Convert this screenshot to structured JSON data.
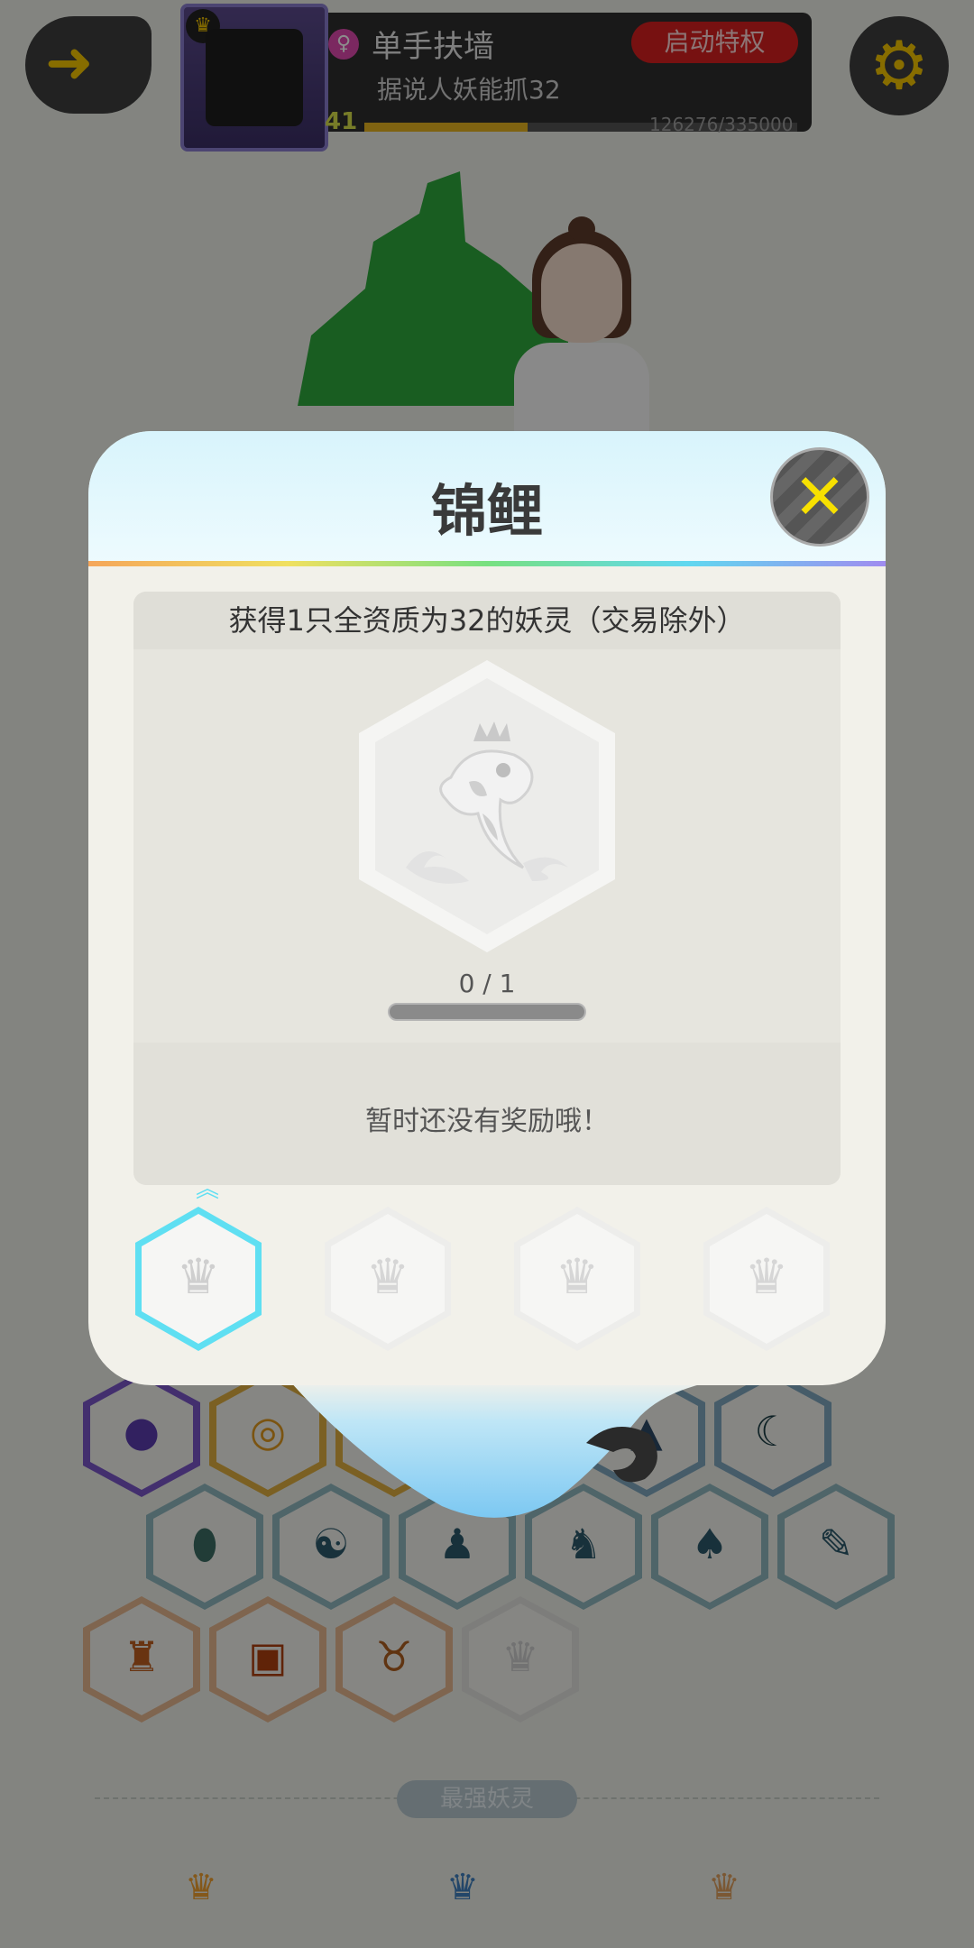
{
  "header": {
    "player_name": "单手扶墙",
    "player_title": "据说人妖能抓32",
    "level": "41",
    "exp_text": "126276/335000",
    "exp_fraction": 0.377,
    "privilege_label": "启动特权"
  },
  "modal": {
    "title": "锦鲤",
    "task_description": "获得1只全资质为32的妖灵（交易除外）",
    "progress_text": "0 / 1",
    "progress_fraction": 0,
    "reward_text": "暂时还没有奖励哦！",
    "tiers": [
      {
        "active": true
      },
      {
        "active": false
      },
      {
        "active": false
      },
      {
        "active": false
      }
    ]
  },
  "background": {
    "strongest_label": "最强妖灵"
  },
  "colors": {
    "accent_cyan": "#5fdff2",
    "close_yellow": "#f7e000",
    "privilege_red": "#d92020",
    "gold": "#f6c700"
  },
  "icons": {
    "back": "back-arrow-icon",
    "settings": "gear-icon",
    "close": "close-icon",
    "koi": "koi-fish-badge-icon"
  }
}
